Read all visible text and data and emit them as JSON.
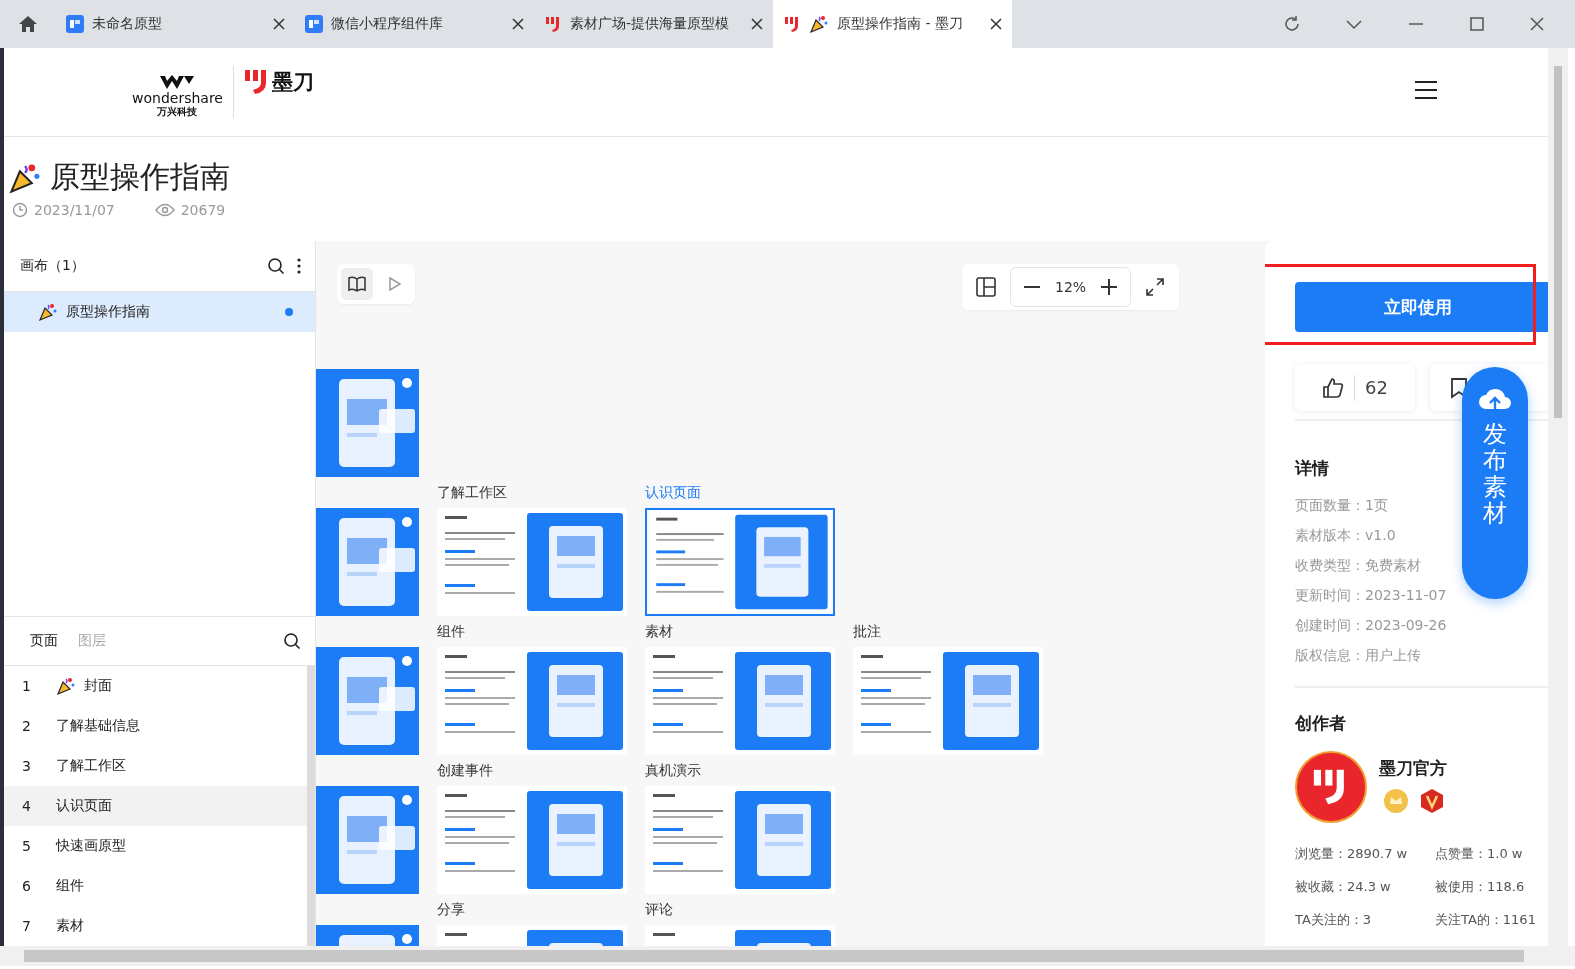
{
  "browser": {
    "tabs": [
      {
        "title": "未命名原型",
        "kind": "app",
        "selected": false
      },
      {
        "title": "微信小程序组件库",
        "kind": "app",
        "selected": false
      },
      {
        "title": "素材广场-提供海量原型模",
        "kind": "site",
        "selected": false
      },
      {
        "title": "原型操作指南 - 墨刀",
        "kind": "document",
        "selected": true
      }
    ]
  },
  "header": {
    "brand": "wondershare",
    "brand_sub": "万兴科技",
    "product": "墨刀"
  },
  "document": {
    "title": "原型操作指南",
    "date": "2023/11/07",
    "views": "20679"
  },
  "canvas_list": {
    "title": "画布（1）",
    "items": [
      {
        "label": "原型操作指南",
        "selected": true,
        "dot": true
      }
    ]
  },
  "pages": {
    "tabs": [
      {
        "label": "页面",
        "selected": true
      },
      {
        "label": "图层",
        "selected": false
      }
    ],
    "items": [
      {
        "number": "1",
        "label": "封面",
        "icon": true,
        "selected": false
      },
      {
        "number": "2",
        "label": "了解基础信息",
        "icon": false,
        "selected": false
      },
      {
        "number": "3",
        "label": "了解工作区",
        "icon": false,
        "selected": false
      },
      {
        "number": "4",
        "label": "认识页面",
        "icon": false,
        "selected": true
      },
      {
        "number": "5",
        "label": "快速画原型",
        "icon": false,
        "selected": false
      },
      {
        "number": "6",
        "label": "组件",
        "icon": false,
        "selected": false
      },
      {
        "number": "7",
        "label": "素材",
        "icon": false,
        "selected": false
      }
    ]
  },
  "canvas": {
    "modes": [
      {
        "kind": "book",
        "selected": true
      },
      {
        "kind": "play",
        "selected": false
      }
    ],
    "zoom": "12%",
    "rows": [
      [
        {
          "kind": "cut"
        }
      ],
      [
        {
          "kind": "cut"
        },
        {
          "kind": "page",
          "label": "了解工作区",
          "selected": false
        },
        {
          "kind": "page",
          "label": "认识页面",
          "selected": true
        }
      ],
      [
        {
          "kind": "cut"
        },
        {
          "kind": "page",
          "label": "组件",
          "selected": false
        },
        {
          "kind": "page",
          "label": "素材",
          "selected": false
        },
        {
          "kind": "page",
          "label": "批注",
          "selected": false
        }
      ],
      [
        {
          "kind": "cut"
        },
        {
          "kind": "page",
          "label": "创建事件",
          "selected": false
        },
        {
          "kind": "page",
          "label": "真机演示",
          "selected": false
        }
      ],
      [
        {
          "kind": "cut"
        },
        {
          "kind": "page",
          "label": "分享",
          "selected": false
        },
        {
          "kind": "page",
          "label": "评论",
          "selected": false
        }
      ]
    ]
  },
  "sidebar": {
    "use_button": "立即使用",
    "like_count": "62",
    "publish": "发布素材",
    "details_title": "详情",
    "details": [
      {
        "label": "页面数量：",
        "value": "1页"
      },
      {
        "label": "素材版本：",
        "value": "v1.0"
      },
      {
        "label": "收费类型：",
        "value": "免费素材"
      },
      {
        "label": "更新时间：",
        "value": "2023-11-07"
      },
      {
        "label": "创建时间：",
        "value": "2023-09-26"
      },
      {
        "label": "版权信息：",
        "value": "用户上传"
      }
    ],
    "creator_title": "创作者",
    "creator_name": "墨刀官方",
    "stats": [
      {
        "label": "浏览量：",
        "value": "2890.7 w"
      },
      {
        "label": "点赞量：",
        "value": "1.0 w"
      },
      {
        "label": "被收藏：",
        "value": "24.3 w"
      },
      {
        "label": "被使用：",
        "value": "118.6"
      },
      {
        "label": "TA关注的：",
        "value": "3"
      },
      {
        "label": "关注TA的：",
        "value": "1161"
      }
    ]
  }
}
